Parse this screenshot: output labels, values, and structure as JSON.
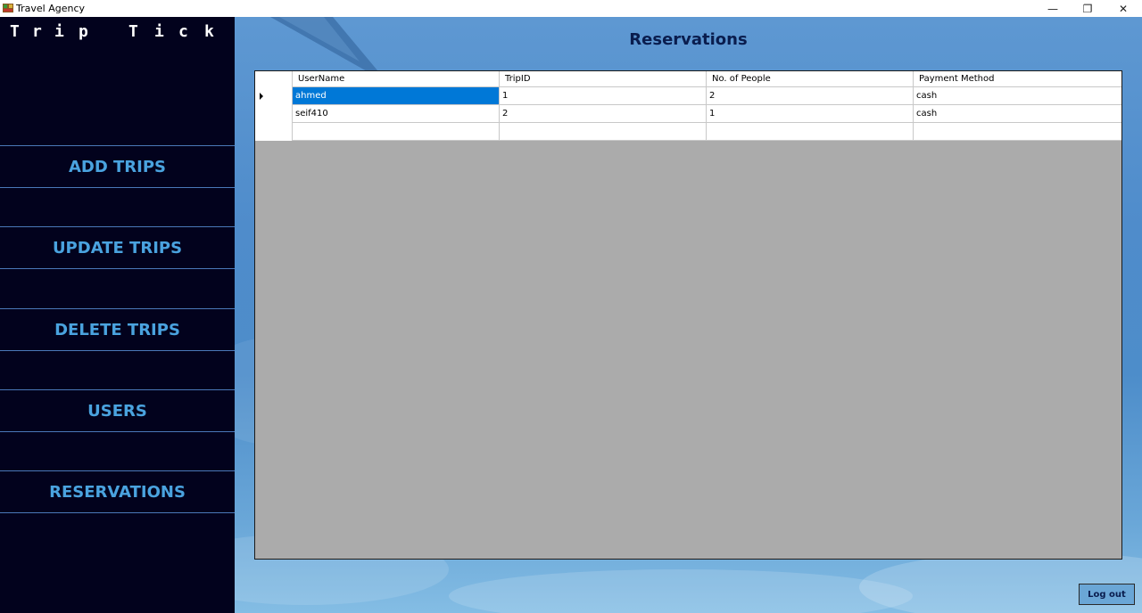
{
  "window": {
    "title": "Travel Agency",
    "icon": "travel-agency-icon",
    "minimize_glyph": "—",
    "maximize_glyph": "❐",
    "close_glyph": "✕"
  },
  "sidebar": {
    "logo_letters": [
      "T",
      "r",
      "i",
      "p",
      "T",
      "i",
      "c",
      "k"
    ],
    "items": [
      {
        "label": "ADD TRIPS"
      },
      {
        "label": "UPDATE TRIPS"
      },
      {
        "label": "DELETE TRIPS"
      },
      {
        "label": "USERS"
      },
      {
        "label": "RESERVATIONS"
      }
    ],
    "colors": {
      "background": "#02021d",
      "accent": "#4aa3df",
      "divider": "#4a78b8"
    }
  },
  "main": {
    "title": "Reservations",
    "grid": {
      "columns": [
        "UserName",
        "TripID",
        "No. of People",
        "Payment Method"
      ],
      "rows": [
        [
          "ahmed",
          "1",
          "2",
          "cash"
        ],
        [
          "seif410",
          "2",
          "1",
          "cash"
        ]
      ],
      "selected_row": 0,
      "selected_column": 0,
      "selection_color": "#0078d7"
    },
    "logout_label": "Log out"
  }
}
